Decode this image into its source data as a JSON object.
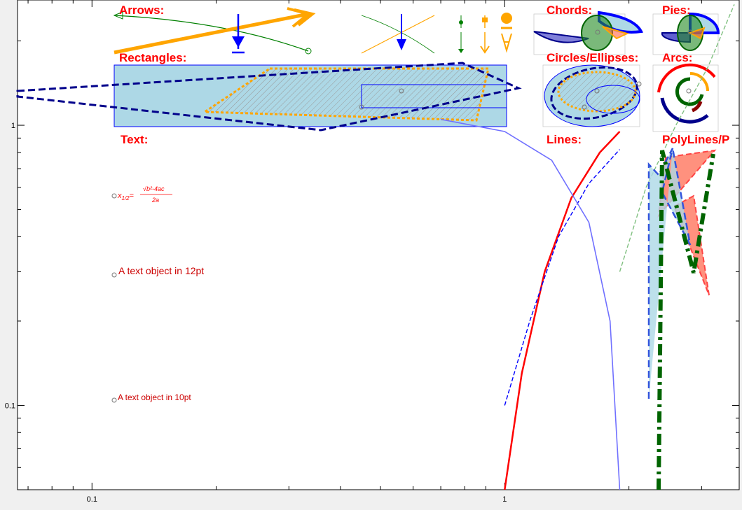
{
  "labels": {
    "arrows": "Arrows:",
    "rectangles": "Rectangles:",
    "text": "Text:",
    "chords": "Chords:",
    "pies": "Pies:",
    "circles": "Circles/Ellipses:",
    "arcs": "Arcs:",
    "lines": "Lines:",
    "polylines": "PolyLines/P",
    "text12": "A text object in 12pt",
    "text10": "A text object in 10pt",
    "formula": "x1/2 = (√(b²-4ac))/2a"
  },
  "chart_data": {
    "type": "line",
    "title": "",
    "xlabel": "",
    "ylabel": "",
    "xscale": "log",
    "yscale": "log",
    "xlim": [
      0.066,
      3.7
    ],
    "ylim": [
      0.05,
      2.8
    ],
    "x_ticks": [
      {
        "value": 0.1,
        "label": "0.1"
      },
      {
        "value": 1,
        "label": "1"
      }
    ],
    "y_ticks": [
      {
        "value": 0.1,
        "label": "0.1"
      },
      {
        "value": 1,
        "label": "1"
      }
    ],
    "grid": false,
    "series": [
      {
        "color": "#ff0000",
        "style": "solid",
        "x": [
          1.0,
          1.1,
          1.25,
          1.45,
          1.7,
          1.9
        ],
        "y": [
          0.05,
          0.13,
          0.3,
          0.55,
          0.8,
          0.95
        ]
      },
      {
        "color": "#0000ff",
        "style": "dashed",
        "x": [
          1.0,
          1.15,
          1.35,
          1.6,
          1.9
        ],
        "y": [
          0.1,
          0.2,
          0.4,
          0.62,
          0.82
        ]
      },
      {
        "color": "#7070ff",
        "style": "solid",
        "x": [
          0.7,
          1.0,
          1.3,
          1.6,
          1.8,
          1.9
        ],
        "y": [
          1.05,
          0.95,
          0.75,
          0.45,
          0.2,
          0.05
        ]
      },
      {
        "color": "#80c080",
        "style": "dashed",
        "x": [
          1.9,
          2.2,
          2.6,
          3.1,
          3.6
        ],
        "y": [
          0.3,
          0.6,
          1.0,
          1.6,
          2.7
        ]
      }
    ]
  }
}
